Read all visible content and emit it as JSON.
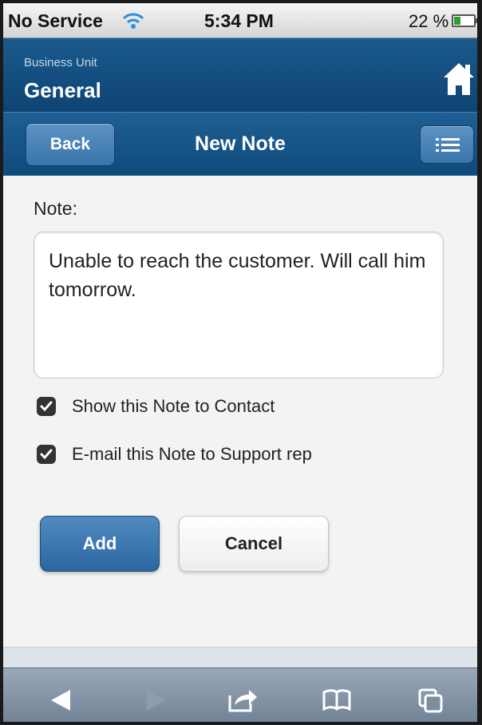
{
  "status_bar": {
    "carrier": "No Service",
    "time": "5:34 PM",
    "battery_percent": "22 %",
    "battery_level": 0.22
  },
  "header": {
    "label": "Business Unit",
    "name": "General",
    "home_icon": "home-icon"
  },
  "navbar": {
    "back_label": "Back",
    "title": "New Note",
    "menu_icon": "list-menu-icon"
  },
  "form": {
    "note_label": "Note:",
    "note_value": "Unable to reach the customer. Will call him tomorrow.",
    "checkboxes": [
      {
        "label": "Show this Note to Contact",
        "checked": true
      },
      {
        "label": "E-mail this Note to Support rep",
        "checked": true
      }
    ],
    "add_label": "Add",
    "cancel_label": "Cancel"
  },
  "toolbar": {
    "icons": [
      "back-arrow-icon",
      "forward-arrow-icon",
      "share-icon",
      "bookmarks-icon",
      "tabs-icon"
    ]
  },
  "colors": {
    "header_blue": "#0e4474",
    "button_blue": "#2c66a0",
    "toolbar_gray": "#6e7f93"
  }
}
